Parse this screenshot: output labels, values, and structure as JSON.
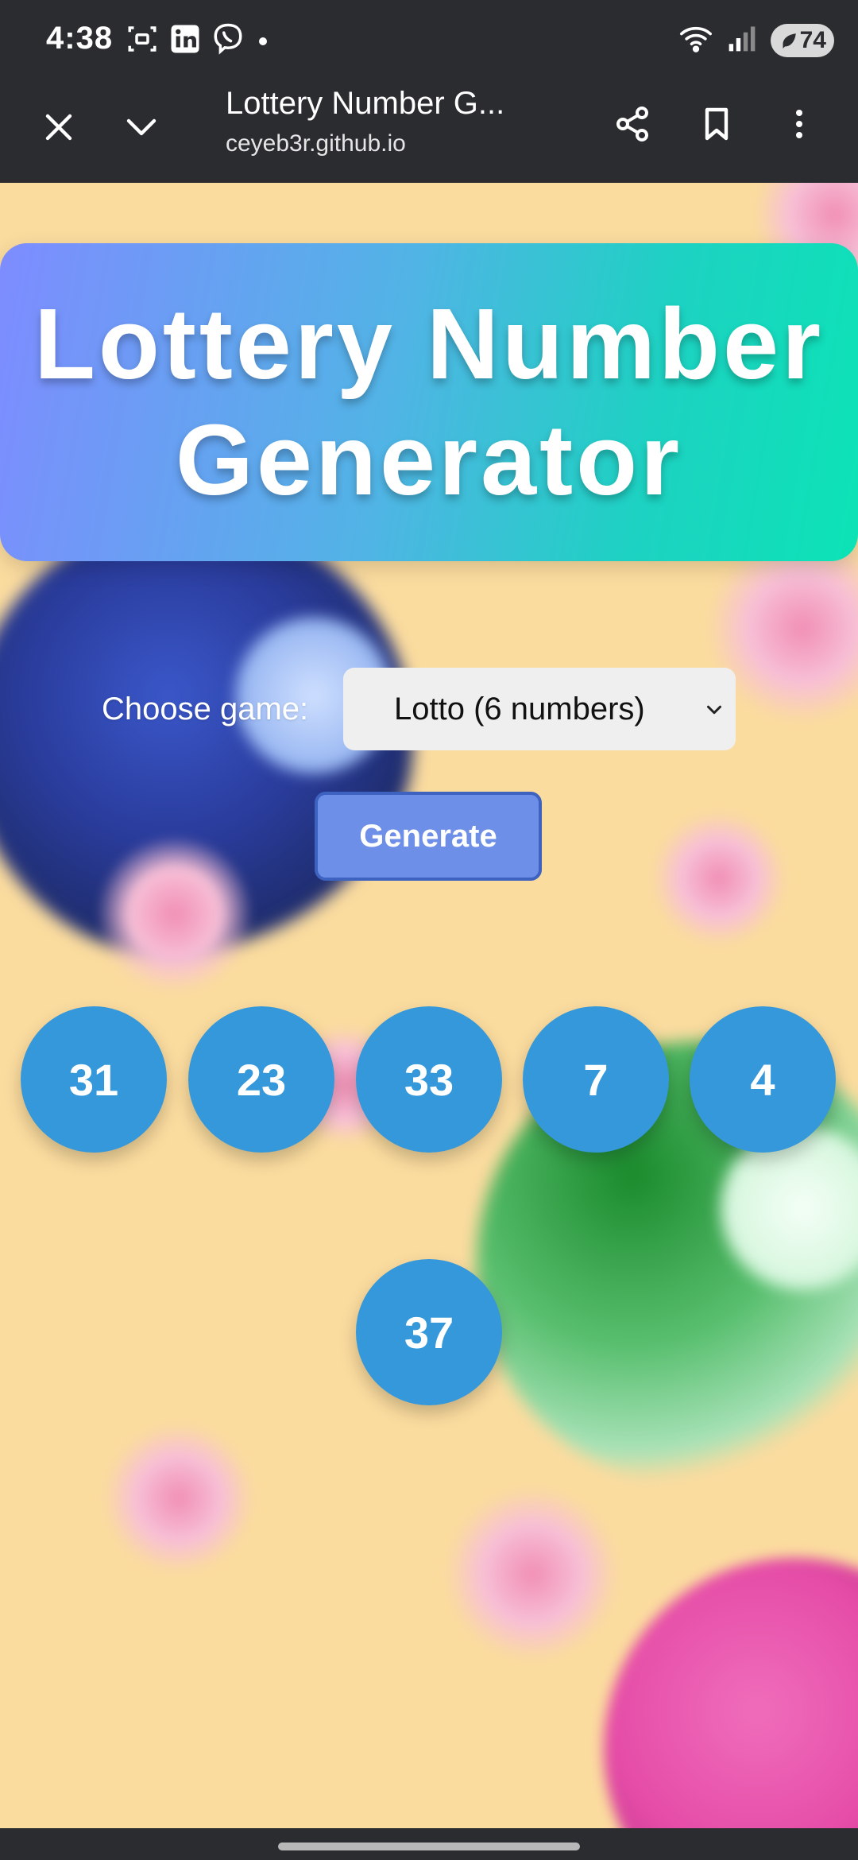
{
  "status_bar": {
    "time": "4:38",
    "battery": "74",
    "left_icons": [
      "screenshot-icon",
      "linkedin-icon",
      "viber-icon",
      "notification-dot"
    ],
    "right_icons": [
      "wifi-icon",
      "signal-icon",
      "battery-icon"
    ]
  },
  "browser": {
    "title": "Lottery Number G...",
    "url": "ceyeb3r.github.io",
    "icons": [
      "close-icon",
      "chevron-down-icon",
      "share-icon",
      "bookmark-icon",
      "more-vert-icon"
    ]
  },
  "page": {
    "heading": "Lottery Number Generator",
    "choose_label": "Choose game:",
    "selected_game": "Lotto (6 numbers)",
    "generate_label": "Generate",
    "numbers": [
      "31",
      "23",
      "33",
      "7",
      "4",
      "37"
    ],
    "ball_color": "#3498db",
    "banner_gradient": [
      "#7e8cff",
      "#0ce3b6"
    ],
    "background_color": "#fbdc9f"
  }
}
